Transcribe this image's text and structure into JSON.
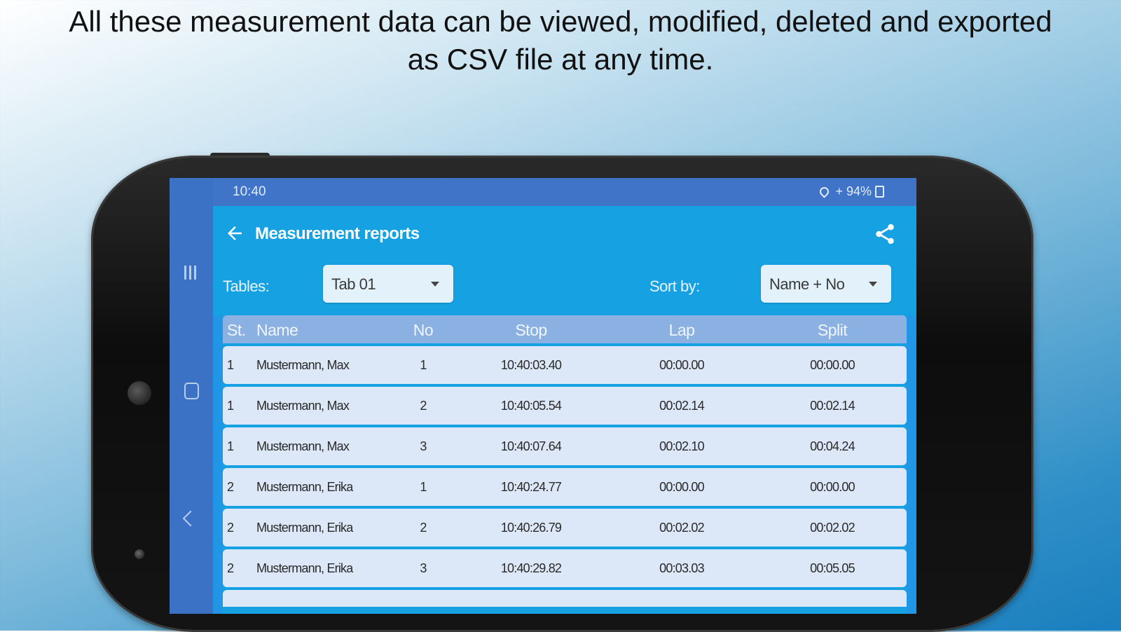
{
  "headline": {
    "line1": "All these measurement data can be viewed, modified, deleted and exported",
    "line2": "as CSV file at any time."
  },
  "status_bar": {
    "time": "10:40",
    "battery": "94%"
  },
  "app_bar": {
    "title": "Measurement reports",
    "back_icon": "arrow-left-icon",
    "share_icon": "share-icon"
  },
  "filters": {
    "tables_label": "Tables:",
    "tables_value": "Tab 01",
    "sort_label": "Sort by:",
    "sort_value": "Name + No"
  },
  "table": {
    "columns": [
      "St.",
      "Name",
      "No",
      "Stop",
      "Lap",
      "Split"
    ],
    "rows": [
      {
        "st": "1",
        "name": "Mustermann, Max",
        "no": "1",
        "stop": "10:40:03.40",
        "lap": "00:00.00",
        "split": "00:00.00"
      },
      {
        "st": "1",
        "name": "Mustermann, Max",
        "no": "2",
        "stop": "10:40:05.54",
        "lap": "00:02.14",
        "split": "00:02.14"
      },
      {
        "st": "1",
        "name": "Mustermann, Max",
        "no": "3",
        "stop": "10:40:07.64",
        "lap": "00:02.10",
        "split": "00:04.24"
      },
      {
        "st": "2",
        "name": "Mustermann, Erika",
        "no": "1",
        "stop": "10:40:24.77",
        "lap": "00:00.00",
        "split": "00:00.00"
      },
      {
        "st": "2",
        "name": "Mustermann, Erika",
        "no": "2",
        "stop": "10:40:26.79",
        "lap": "00:02.02",
        "split": "00:02.02"
      },
      {
        "st": "2",
        "name": "Mustermann, Erika",
        "no": "3",
        "stop": "10:40:29.82",
        "lap": "00:03.03",
        "split": "00:05.05"
      }
    ]
  },
  "colors": {
    "appbar": "#16a1e2",
    "statusbar": "#3f74c8",
    "navbar": "#3c72c6",
    "header_row": "#8ab1e2",
    "row": "#dce7f7"
  }
}
